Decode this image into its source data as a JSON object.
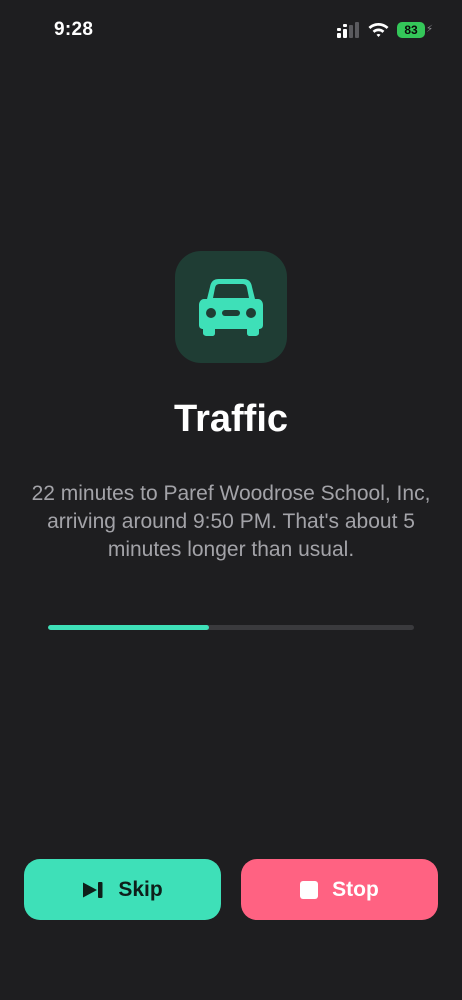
{
  "status_bar": {
    "time": "9:28",
    "battery_level": "83",
    "icons": [
      "signal-icon",
      "wifi-icon",
      "battery-icon"
    ]
  },
  "shortcut": {
    "icon": "car-icon",
    "title": "Traffic",
    "message": "22 minutes to Paref Woodrose School, Inc, arriving around 9:50 PM. That's about 5 minutes longer than usual.",
    "progress": 0.44
  },
  "actions": {
    "skip_label": "Skip",
    "skip_icon": "skip-forward-icon",
    "stop_label": "Stop",
    "stop_icon": "stop-icon"
  },
  "colors": {
    "background": "#1e1e20",
    "accent": "#3ee0b8",
    "stop": "#ff6282",
    "icon_tile": "#1f3d34",
    "message_text": "#a3a3a8"
  }
}
